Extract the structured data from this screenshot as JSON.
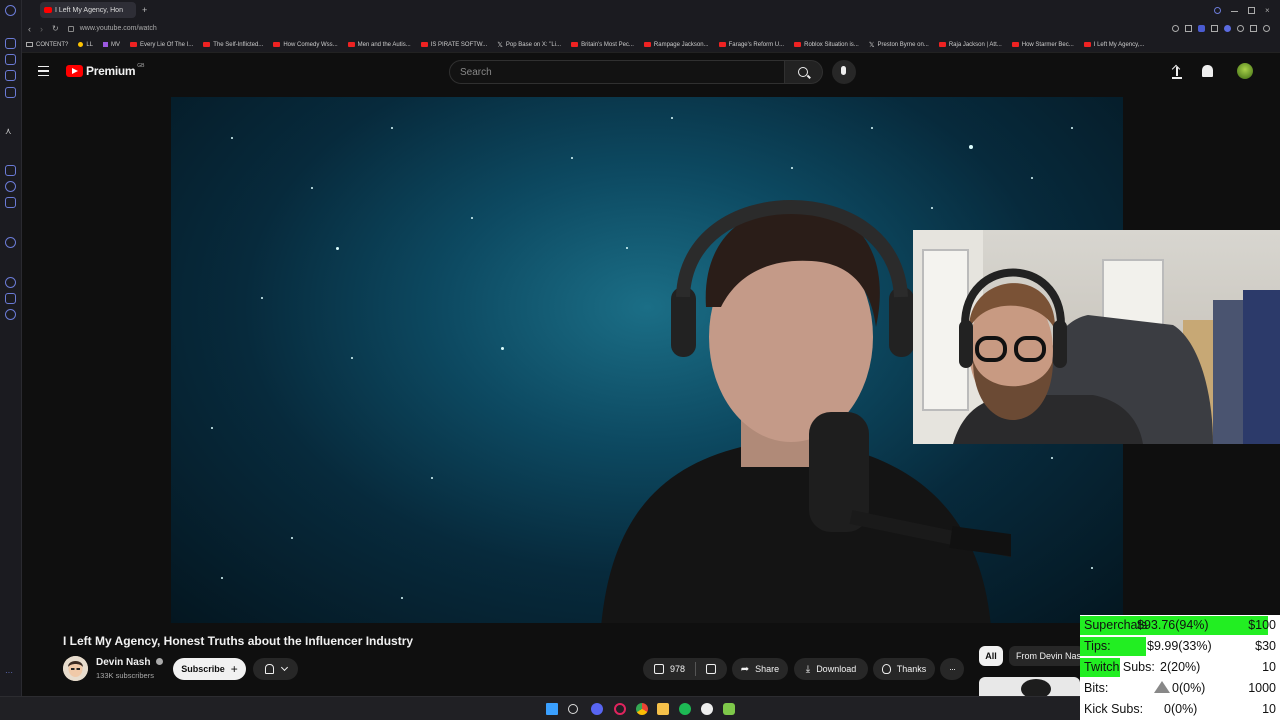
{
  "browser": {
    "active_tab_title": "I Left My Agency, Hon",
    "new_tab_label": "+",
    "url": "www.youtube.com/watch",
    "bookmarks": [
      "CONTENT?",
      "LL",
      "MV",
      "Every Lie Of The I...",
      "The Self-Inflicted...",
      "How Comedy Wss...",
      "Men and the Autis...",
      "IS PIRATE SOFTW...",
      "Pop Base on X: \"Li...",
      "Britain's Most Pec...",
      "Rampage Jackson...",
      "Farage's Reform U...",
      "Roblox Situation is...",
      "Preston Byrne on...",
      "Raja Jackson | Att...",
      "How Starmer Bec...",
      "I Left My Agency,..."
    ]
  },
  "youtube": {
    "logo_text": "Premium",
    "logo_region": "GB",
    "search_placeholder": "Search"
  },
  "video": {
    "title": "I Left My Agency, Honest Truths about the Influencer Industry",
    "channel_name": "Devin Nash",
    "subscribers": "133K subscribers",
    "subscribe_label": "Subscribe",
    "like_count": "978",
    "share_label": "Share",
    "download_label": "Download",
    "thanks_label": "Thanks",
    "more_label": "···"
  },
  "recommendation_chips": {
    "all": "All",
    "from": "From Devin Nash"
  },
  "stats_overlay": {
    "rows": [
      {
        "label": "Superchats",
        "value": "$93.76(94%)",
        "goal": "$100",
        "fraction": 0.94,
        "color": "#22ee22"
      },
      {
        "label": "Tips:",
        "value": "$9.99(33%)",
        "goal": "$30",
        "fraction": 0.33,
        "color": "#22ee22"
      },
      {
        "label": "Twitch Subs:",
        "value": "2(20%)",
        "goal": "10",
        "fraction": 0.2,
        "color": "#22ee22"
      },
      {
        "label": "Bits:",
        "value": "0(0%)",
        "goal": "1000",
        "fraction": 0.0,
        "color": "#22ee22"
      },
      {
        "label": "Kick Subs:",
        "value": "0(0%)",
        "goal": "10",
        "fraction": 0.0,
        "color": "#22ee22"
      }
    ]
  },
  "colors": {
    "youtube_red": "#ff0000",
    "background": "#0f0f0f",
    "progress_green": "#22ee22"
  }
}
